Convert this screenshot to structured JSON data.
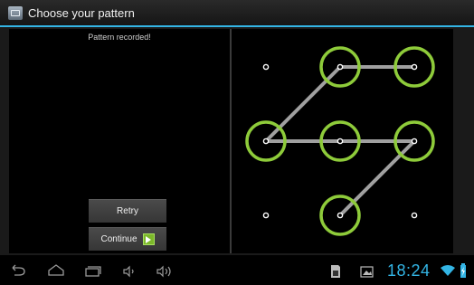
{
  "title": "Choose your pattern",
  "status_message": "Pattern recorded!",
  "buttons": {
    "retry": "Retry",
    "continue": "Continue"
  },
  "pattern": {
    "path": [
      [
        1,
        1
      ],
      [
        0,
        2
      ],
      [
        1,
        2
      ],
      [
        2,
        2
      ],
      [
        2,
        1
      ],
      [
        1,
        0
      ],
      [
        1,
        3
      ]
    ],
    "selected_dots": [
      1,
      2,
      4,
      5,
      6,
      10
    ],
    "accent_color": "#8ecb3a",
    "line_color": "#a0a0a0"
  },
  "system_bar": {
    "clock": "18:24",
    "accent_color": "#33b5e5",
    "icons": [
      "back-icon",
      "home-icon",
      "recent-apps-icon",
      "volume-down-icon",
      "volume-up-icon",
      "sd-card-icon",
      "screenshot-icon",
      "wifi-icon",
      "battery-icon"
    ]
  }
}
